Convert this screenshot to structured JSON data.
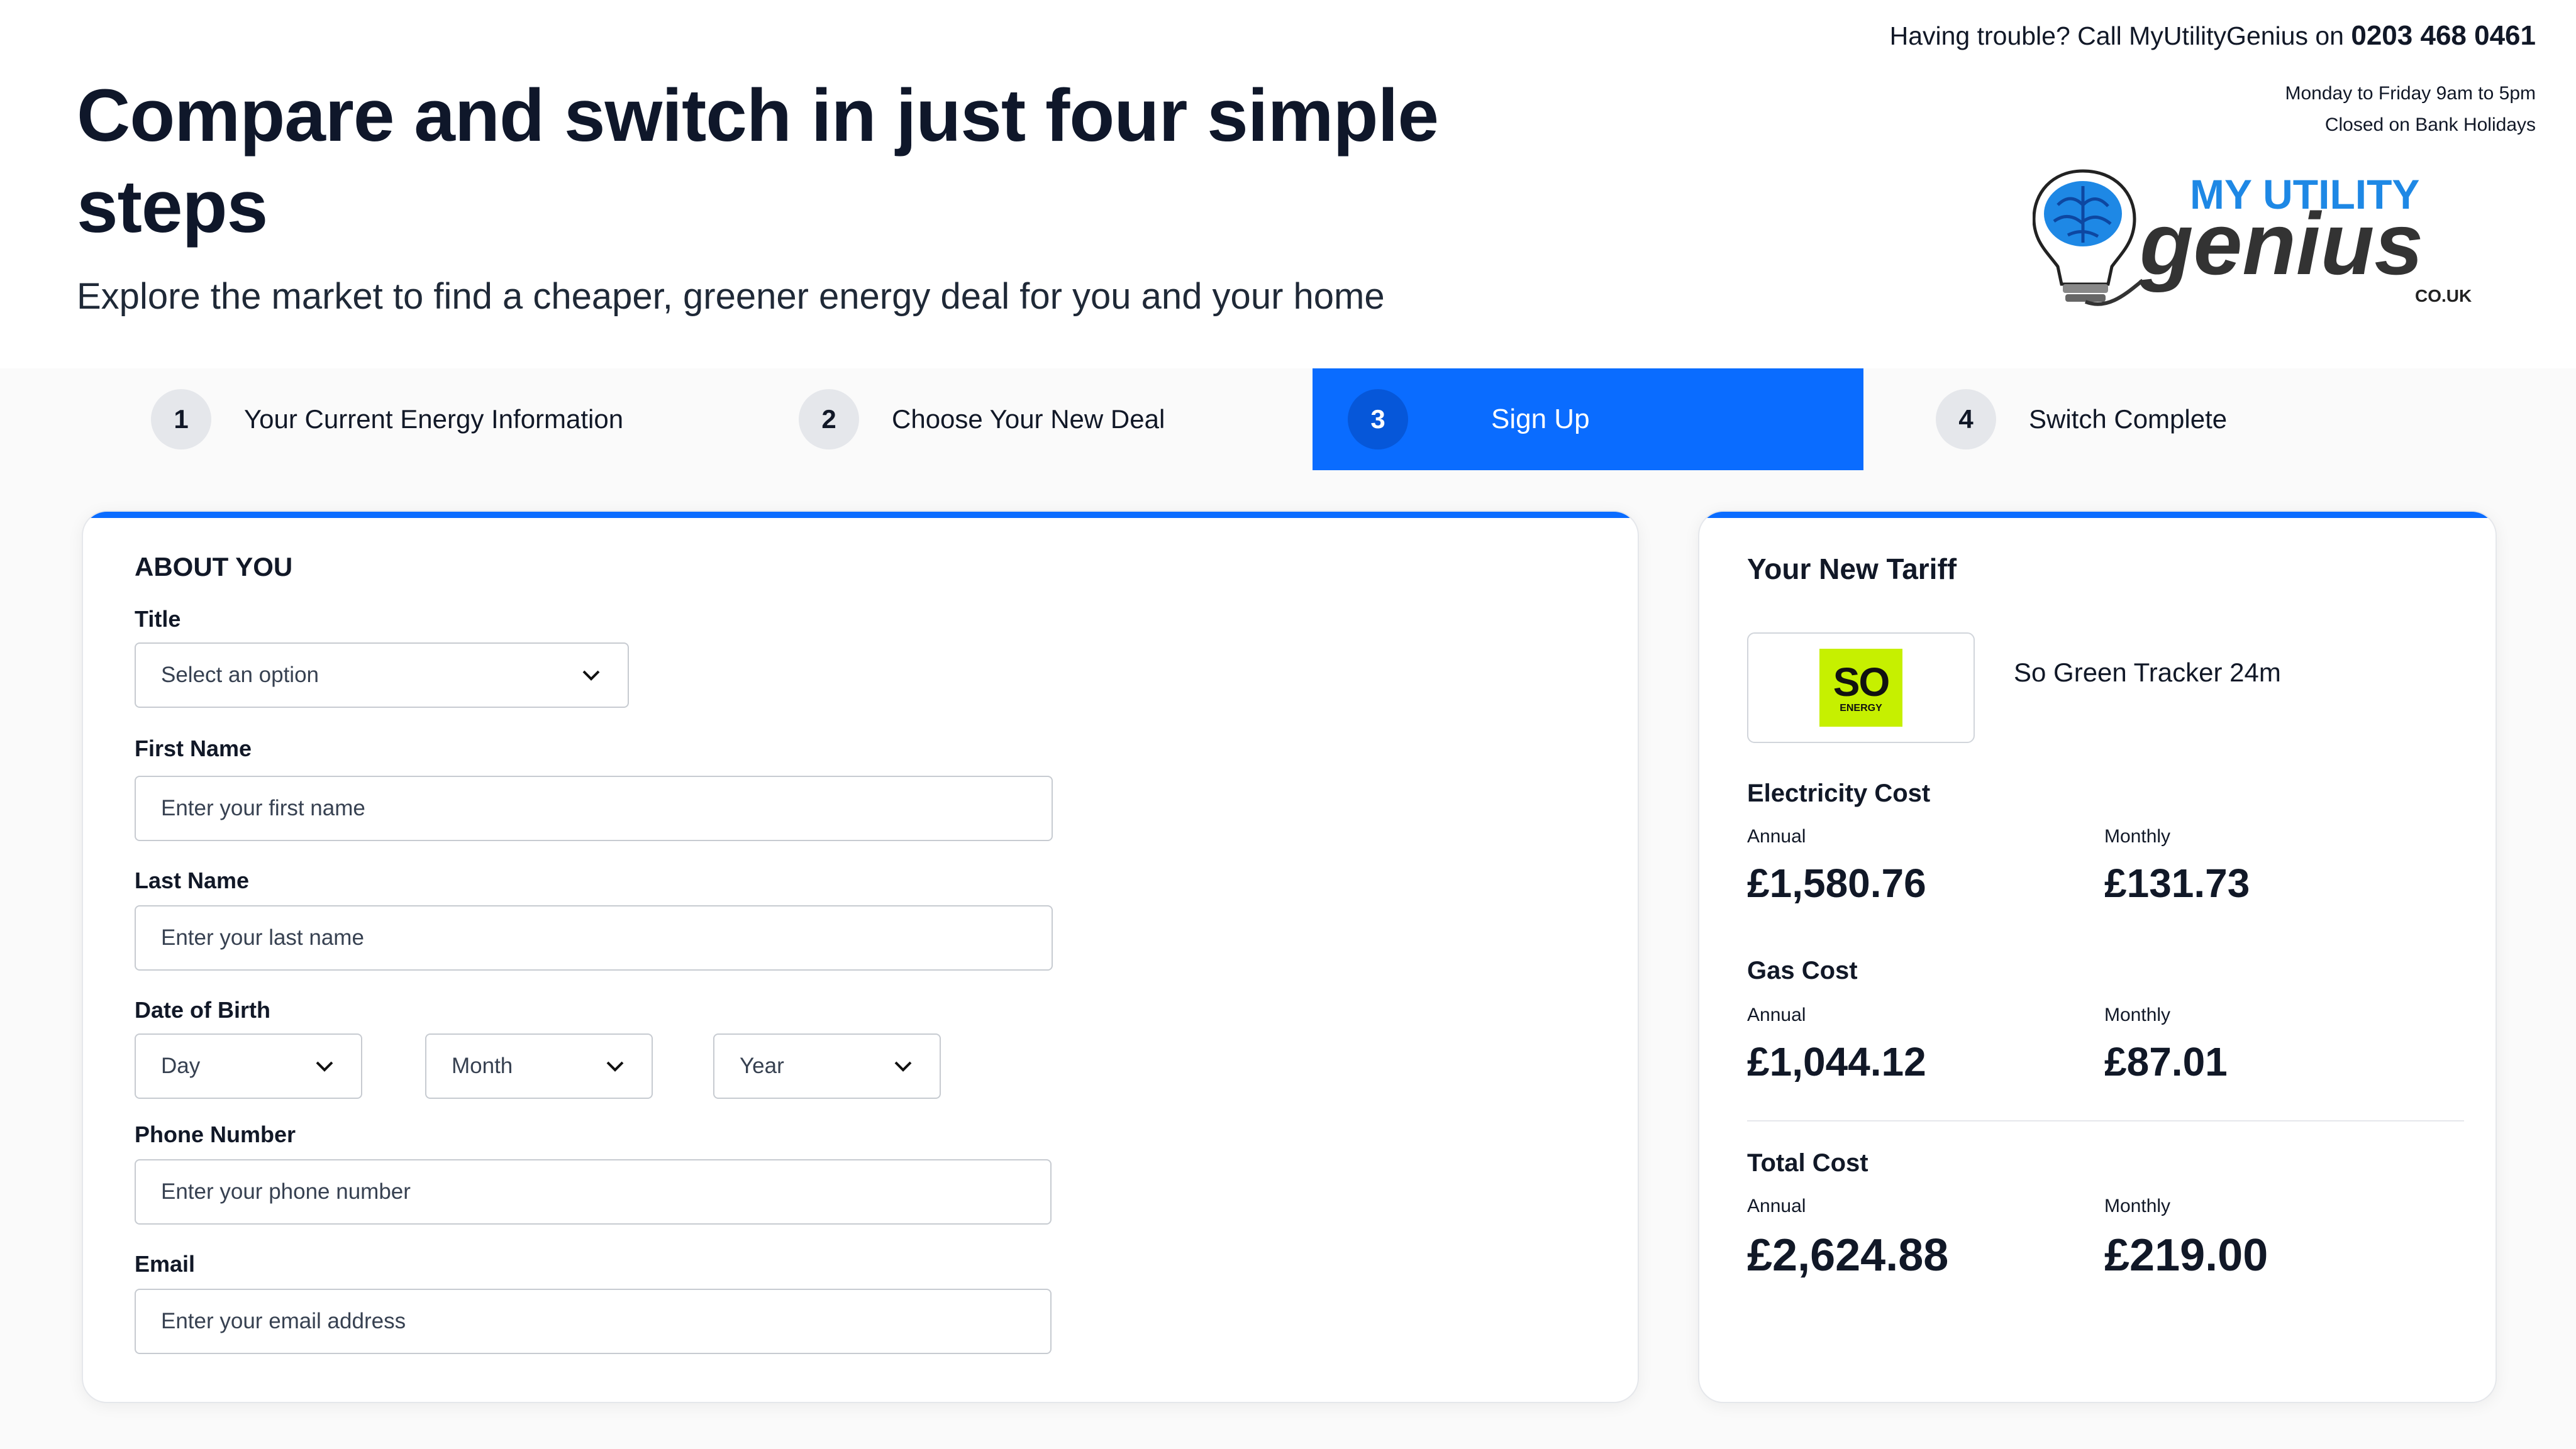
{
  "header": {
    "headline": "Compare and switch in just four simple steps",
    "subhead": "Explore the market to find a cheaper, greener energy deal for you and your home",
    "contact_prefix": "Having trouble? Call MyUtilityGenius on ",
    "contact_phone": "0203 468 0461",
    "hours_line1": "Monday to Friday 9am to 5pm",
    "hours_line2": "Closed on Bank Holidays",
    "logo": {
      "line1": "MY UTILITY",
      "line2": "genius",
      "line3": "CO.UK",
      "icon": "lightbulb-brain-icon"
    }
  },
  "steps": [
    {
      "num": "1",
      "label": "Your Current Energy Information"
    },
    {
      "num": "2",
      "label": "Choose Your New Deal"
    },
    {
      "num": "3",
      "label": "Sign Up"
    },
    {
      "num": "4",
      "label": "Switch Complete"
    }
  ],
  "active_step": "3",
  "form": {
    "section_title": "ABOUT YOU",
    "title_label": "Title",
    "title_select": "Select an option",
    "first_name_label": "First Name",
    "first_name_placeholder": "Enter your first name",
    "last_name_label": "Last Name",
    "last_name_placeholder": "Enter your last name",
    "dob_label": "Date of Birth",
    "dob_day": "Day",
    "dob_month": "Month",
    "dob_year": "Year",
    "phone_label": "Phone Number",
    "phone_placeholder": "Enter your phone number",
    "email_label": "Email",
    "email_placeholder": "Enter your email address"
  },
  "tariff": {
    "title": "Your New Tariff",
    "supplier_logo_text": "SO",
    "supplier_logo_subtext": "ENERGY",
    "tariff_name": "So Green Tracker 24m",
    "electricity": {
      "title": "Electricity Cost",
      "annual_label": "Annual",
      "annual": "£1,580.76",
      "monthly_label": "Monthly",
      "monthly": "£131.73"
    },
    "gas": {
      "title": "Gas Cost",
      "annual_label": "Annual",
      "annual": "£1,044.12",
      "monthly_label": "Monthly",
      "monthly": "£87.01"
    },
    "total": {
      "title": "Total Cost",
      "annual_label": "Annual",
      "annual": "£2,624.88",
      "monthly_label": "Monthly",
      "monthly": "£219.00"
    }
  },
  "colors": {
    "accent": "#0a6cff",
    "brand_logo_green": "#c6f000"
  }
}
